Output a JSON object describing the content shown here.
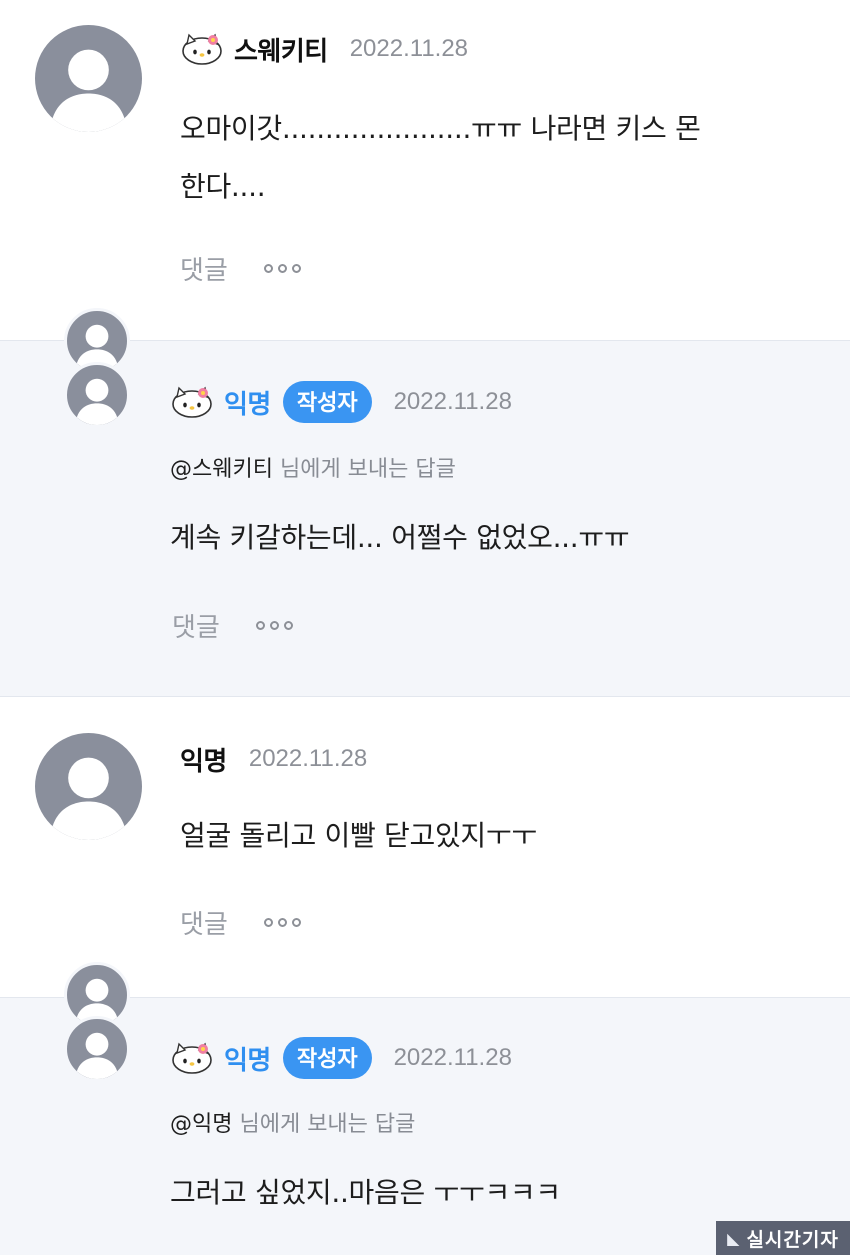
{
  "comments": [
    {
      "author": "스웨키티",
      "date": "2022.11.28",
      "text_line1": "오마이갓......................ㅠㅠ 나라면 키스 몬",
      "text_line2": "한다....",
      "reply_label": "댓글"
    },
    {
      "author": "익명",
      "badge": "작성자",
      "date": "2022.11.28",
      "mention_target": "@스웨키티",
      "mention_suffix": " 님에게 보내는 답글",
      "text": "계속 키갈하는데... 어쩔수 없었오...ㅠㅠ",
      "reply_label": "댓글"
    },
    {
      "author": "익명",
      "date": "2022.11.28",
      "text": "얼굴 돌리고 이빨 닫고있지ㅜㅜ",
      "reply_label": "댓글"
    },
    {
      "author": "익명",
      "badge": "작성자",
      "date": "2022.11.28",
      "mention_target": "@익명",
      "mention_suffix": " 님에게 보내는 답글",
      "text": "그러고 싶었지..마음은 ㅜㅜㅋㅋㅋ"
    }
  ],
  "watermark": {
    "logo": "◣",
    "text": "실시간기자"
  },
  "icons": {
    "avatar": "default-user-avatar-icon",
    "profile_badge": "hello-kitty-icon",
    "more": "more-dots-icon"
  },
  "colors": {
    "accent": "#3a95f2",
    "reply_bg": "#f4f6fa",
    "avatar": "#8a8f9c"
  }
}
